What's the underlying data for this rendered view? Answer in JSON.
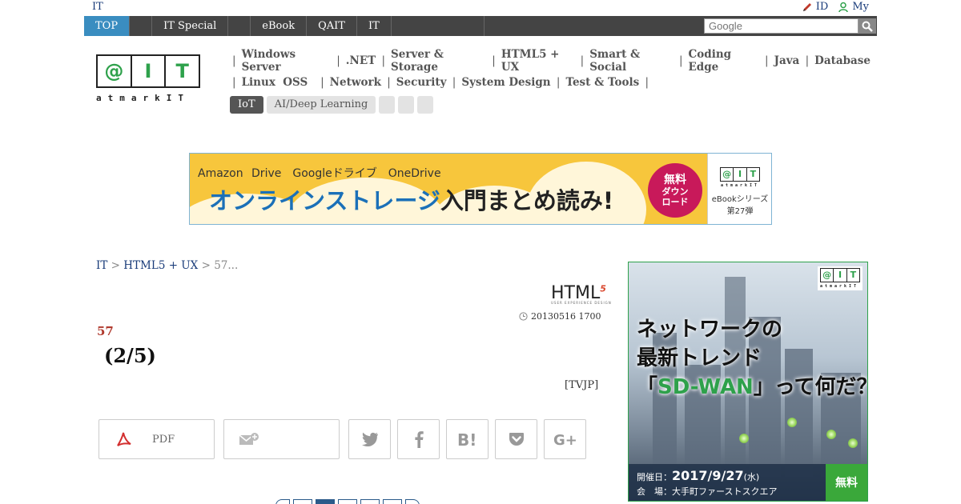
{
  "topbar": {
    "site_link": "IT",
    "id_label": "ID",
    "my_label": "My"
  },
  "nav": {
    "items": [
      "TOP",
      "IT Special",
      "eBook",
      "QAIT",
      "IT"
    ],
    "search_placeholder": "Google"
  },
  "logo": {
    "letters": [
      "@",
      "I",
      "T"
    ],
    "wordmark": "atmarkIT"
  },
  "categories": {
    "row1": [
      "Windows Server",
      ".NET",
      "Server & Storage",
      "HTML5 + UX",
      "Smart & Social",
      "Coding Edge",
      "Java",
      "Database"
    ],
    "row2": [
      "Linux  OSS",
      "Network",
      "Security",
      "System Design",
      "Test & Tools"
    ],
    "tags": [
      "IoT",
      "AI/Deep Learning"
    ]
  },
  "banner": {
    "services": "Amazon Drive　Googleドライブ　OneDrive",
    "headline_blue": "オンラインストレージ",
    "headline_dark": "入門まとめ読み!",
    "badge_line1": "無料",
    "badge_line2": "ダウン",
    "badge_line3": "ロード",
    "series": "eBookシリーズ",
    "issue": "第27弾"
  },
  "breadcrumb": {
    "root": "IT",
    "section": "HTML5 + UX",
    "current": "57..."
  },
  "article": {
    "brand": "HTML",
    "brand_sup": "5",
    "brand_sub": "USER EXPERIENCE DESIGN",
    "date": "20130516 1700",
    "series_number": "57",
    "title": "(2/5)",
    "author": "[TVJP]"
  },
  "share": {
    "pdf_label": "PDF"
  },
  "side_ad": {
    "headline_line1": "ネットワークの",
    "headline_line2": "最新トレンド",
    "headline_pre": "「",
    "headline_green": "SD-WAN",
    "headline_post": "」って何だ？",
    "date_label": "開催日：",
    "date_value": "2017/9/27",
    "date_weekday": "(水)",
    "venue_label": "会　場：",
    "venue_value": "大手町ファーストスクエア",
    "free_label": "無料"
  },
  "colors": {
    "accent_blue": "#3a8dc0",
    "brand_green": "#2ea14b",
    "navbar_bg": "#444444",
    "banner_yellow": "#f7c63c",
    "badge_red": "#c8195a"
  }
}
